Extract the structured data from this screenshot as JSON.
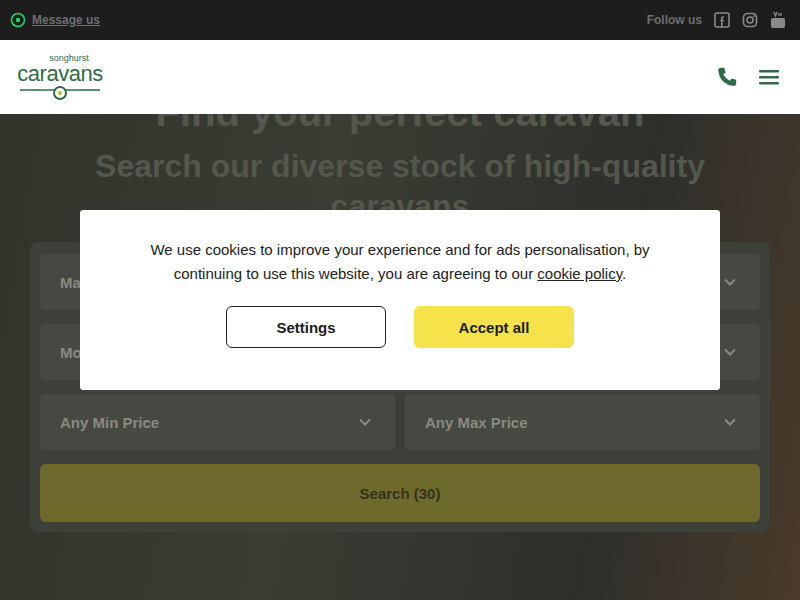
{
  "top_bar": {
    "message": "Message us",
    "follow": "Follow us"
  },
  "logo": {
    "small": "songhurst",
    "main": "caravans"
  },
  "hero": {
    "title": "Find your perfect caravan",
    "subtitle": "Search our diverse stock of high-quality caravans"
  },
  "search": {
    "rows": [
      [
        "Ma"
      ],
      [
        "Mode"
      ],
      [
        "Any Min Price",
        "Any Max Price"
      ]
    ],
    "button": "Search (30)"
  },
  "cookie": {
    "text": "We use cookies to improve your experience and for ads personalisation, by continuing to use this website, you are agreeing to our ",
    "link": "cookie policy",
    "end": ".",
    "buttons": [
      {
        "label": "Settings",
        "primary": false
      },
      {
        "label": "Accept all",
        "primary": true
      }
    ]
  }
}
